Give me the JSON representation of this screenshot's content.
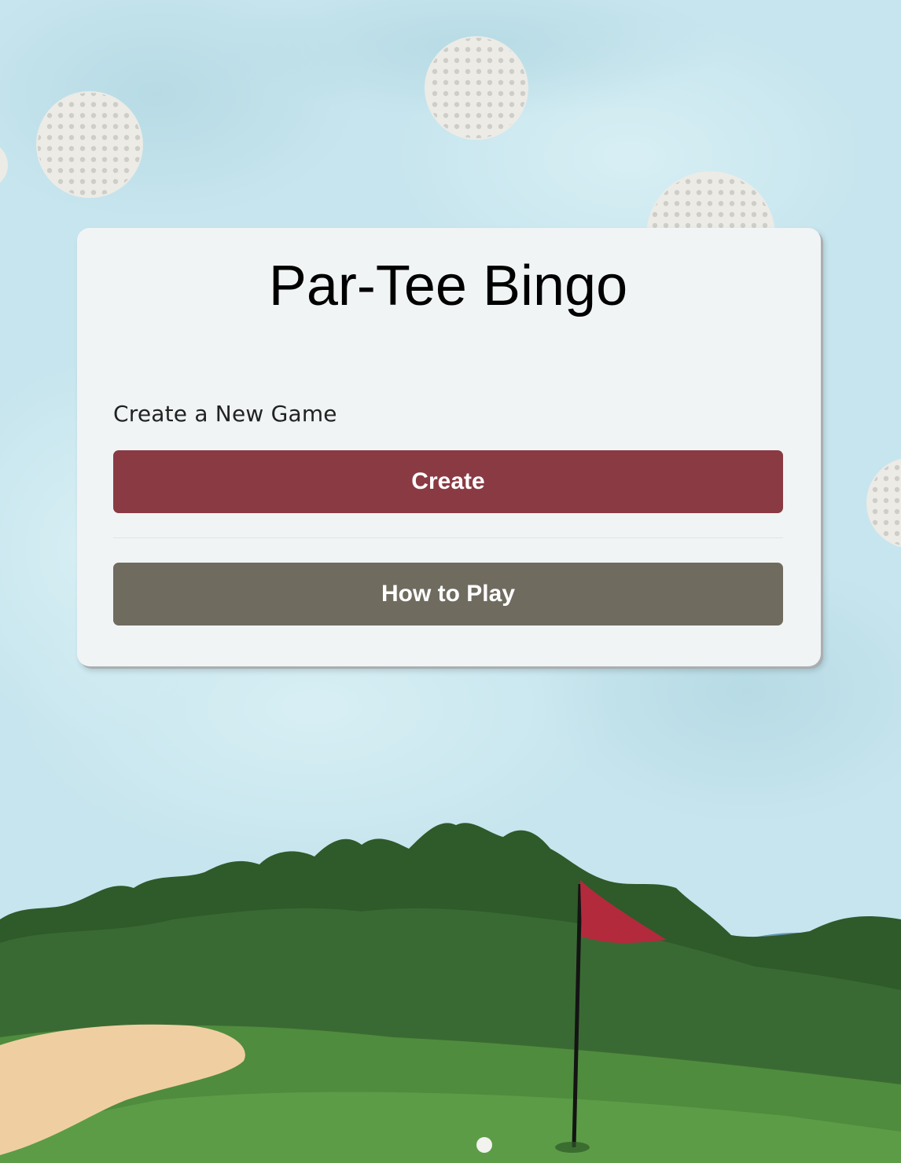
{
  "app": {
    "title": "Par-Tee Bingo"
  },
  "create_section": {
    "label": "Create a New Game",
    "button_label": "Create"
  },
  "how_to_play": {
    "button_label": "How to Play"
  },
  "colors": {
    "create_button": "#8a3a43",
    "how_to_play_button": "#6f6b5f",
    "card_background": "#f0f4f5",
    "sky": "#c9e6ee",
    "grass": "#3f6e3a",
    "flag": "#b32a3d",
    "sand": "#efcfa1"
  },
  "icons": {
    "background": [
      "golf-ball-icon",
      "flag-icon",
      "bunker-icon",
      "tree-line-icon"
    ]
  }
}
